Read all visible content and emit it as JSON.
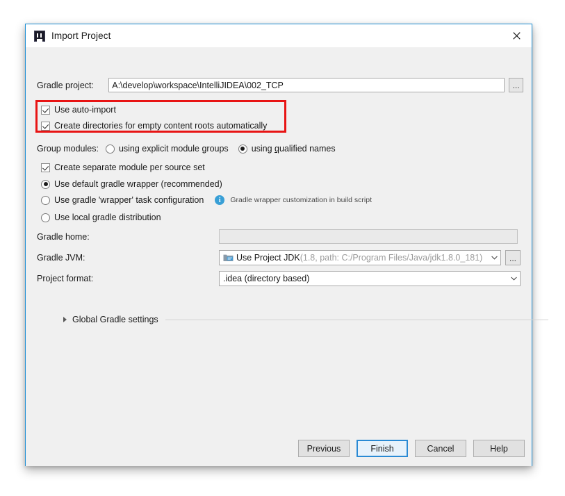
{
  "window": {
    "title": "Import Project",
    "app_icon": "intellij-idea-icon",
    "close_icon": "close-icon",
    "border_color": "#1e8fd5"
  },
  "annotation": {
    "color": "#e81414",
    "shape": "rectangle",
    "targets": [
      "Use auto-import",
      "Create directories for empty content roots automatically"
    ]
  },
  "form": {
    "gradle_project": {
      "label": "Gradle project:",
      "value": "A:\\develop\\workspace\\IntelliJIDEA\\002_TCP",
      "placeholder": "",
      "browse_label": "..."
    },
    "use_auto_import": {
      "label": "Use auto-import",
      "checked": true
    },
    "create_directories": {
      "label": "Create directories for empty content roots automatically",
      "checked": true
    },
    "group_modules": {
      "label": "Group modules:",
      "options": [
        {
          "label_pre": "using explicit module ",
          "label_mnemonic": "g",
          "label_post": "roups",
          "selected": false
        },
        {
          "label_pre": "using ",
          "label_mnemonic": "q",
          "label_post": "ualified names",
          "selected": true
        }
      ]
    },
    "create_separate_module": {
      "label": "Create separate module per source set",
      "checked": true
    },
    "gradle_wrapper_options": [
      {
        "label": "Use default gradle wrapper (recommended)",
        "selected": true,
        "hint": ""
      },
      {
        "label": "Use gradle 'wrapper' task configuration",
        "selected": false,
        "hint": "Gradle wrapper customization in build script",
        "hint_icon": "info-icon"
      },
      {
        "label": "Use local gradle distribution",
        "selected": false,
        "hint": ""
      }
    ],
    "gradle_home": {
      "label": "Gradle home:",
      "value": "",
      "disabled": true,
      "browse_icon": "folder-icon"
    },
    "gradle_jvm": {
      "label": "Gradle JVM:",
      "icon": "jdk-folder-icon",
      "value_main": "Use Project JDK",
      "value_detail": " (1.8, path: C:/Program Files/Java/jdk1.8.0_181)",
      "browse_label": "...",
      "dropdown_icon": "chevron-down-icon"
    },
    "project_format": {
      "label": "Project format:",
      "value": ".idea (directory based)",
      "dropdown_icon": "chevron-down-icon"
    },
    "global_gradle_settings": {
      "label": "Global Gradle settings",
      "expanded": false,
      "toggle_icon": "chevron-right-icon"
    }
  },
  "buttons": {
    "previous": "Previous",
    "finish": "Finish",
    "cancel": "Cancel",
    "help": "Help",
    "default_button": "Finish"
  }
}
